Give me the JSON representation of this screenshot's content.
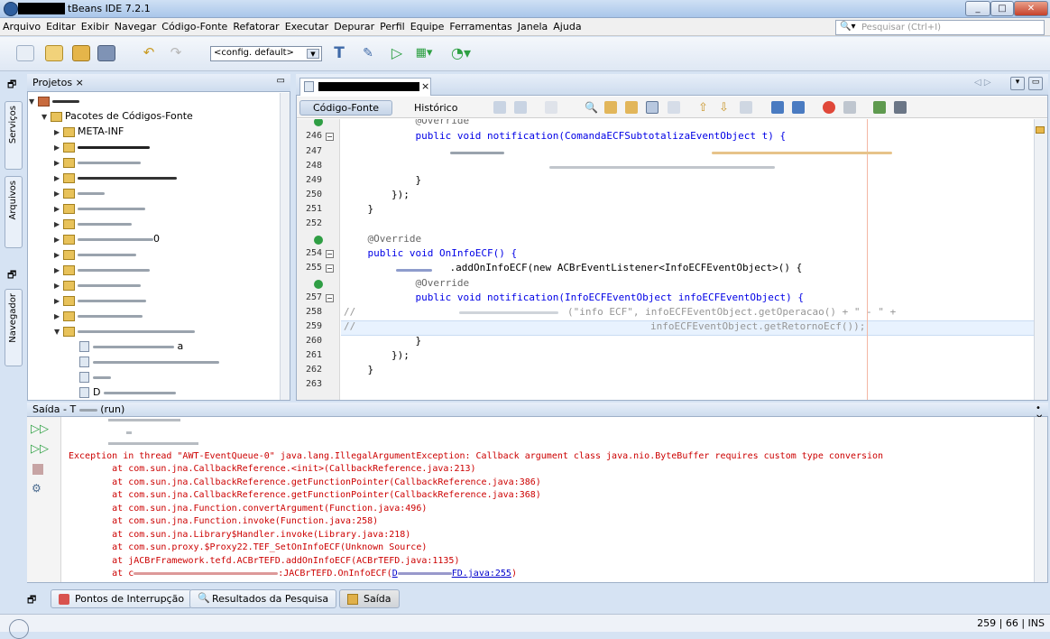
{
  "window": {
    "title": "tBeans IDE 7.2.1",
    "min": "_",
    "max": "□",
    "close": "✕"
  },
  "menu": [
    "Arquivo",
    "Editar",
    "Exibir",
    "Navegar",
    "Código-Fonte",
    "Refatorar",
    "Executar",
    "Depurar",
    "Perfil",
    "Equipe",
    "Ferramentas",
    "Janela",
    "Ajuda"
  ],
  "search": {
    "placeholder": "Pesquisar (Ctrl+I)"
  },
  "toolbar": {
    "config": "<config. default>"
  },
  "side_tabs": {
    "services": "Serviços",
    "files": "Arquivos",
    "navigator": "Navegador"
  },
  "projects": {
    "tab": "Projetos",
    "close": "×",
    "source_packages": "Pacotes de Códigos-Fonte",
    "meta_inf": "META-INF",
    "partial_labels": [
      "0",
      "a",
      "D"
    ]
  },
  "editor": {
    "tab_close": "×",
    "view_source": "Código-Fonte",
    "view_history": "Histórico",
    "lines": [
      {
        "n": "",
        "code": "@Override",
        "cls": "an",
        "indent": "            "
      },
      {
        "n": "246",
        "code": "public void notification(ComandaECFSubtotalizaEventObject t) {",
        "indent": "            "
      },
      {
        "n": "247",
        "code": "",
        "indent": ""
      },
      {
        "n": "248",
        "code": "",
        "indent": ""
      },
      {
        "n": "249",
        "code": "}",
        "indent": "            "
      },
      {
        "n": "250",
        "code": "});",
        "indent": "        "
      },
      {
        "n": "251",
        "code": "}",
        "indent": "    "
      },
      {
        "n": "252",
        "code": "",
        "indent": ""
      },
      {
        "n": "",
        "code": "@Override",
        "indent": "    "
      },
      {
        "n": "254",
        "code": "public void OnInfoECF() {",
        "indent": "    "
      },
      {
        "n": "255",
        "code": ".addOnInfoECF(new ACBrEventListener<InfoECFEventObject>() {",
        "indent": "            "
      },
      {
        "n": "",
        "code": "@Override",
        "indent": "            "
      },
      {
        "n": "257",
        "code": "public void notification(InfoECFEventObject infoECFEventObject) {",
        "indent": "            "
      },
      {
        "n": "258",
        "code": "(\"info ECF\", infoECFEventObject.getOperacao() + \" - \" +",
        "indent": ""
      },
      {
        "n": "259",
        "code": "infoECFEventObject.getRetornoEcf());",
        "indent": ""
      },
      {
        "n": "260",
        "code": "}",
        "indent": "            "
      },
      {
        "n": "261",
        "code": "});",
        "indent": "        "
      },
      {
        "n": "262",
        "code": "}",
        "indent": "    "
      },
      {
        "n": "263",
        "code": "",
        "indent": ""
      }
    ],
    "comment_marker": "//"
  },
  "output": {
    "title": "Saída - T",
    "title_suffix": "(run)",
    "lines": [
      "Exception in thread \"AWT-EventQueue-0\" java.lang.IllegalArgumentException: Callback argument class java.nio.ByteBuffer requires custom type conversion",
      "        at com.sun.jna.CallbackReference.<init>(CallbackReference.java:213)",
      "        at com.sun.jna.CallbackReference.getFunctionPointer(CallbackReference.java:386)",
      "        at com.sun.jna.CallbackReference.getFunctionPointer(CallbackReference.java:368)",
      "        at com.sun.jna.Function.convertArgument(Function.java:496)",
      "        at com.sun.jna.Function.invoke(Function.java:258)",
      "        at com.sun.jna.Library$Handler.invoke(Library.java:218)",
      "        at com.sun.proxy.$Proxy22.TEF_SetOnInfoECF(Unknown Source)",
      "        at jACBrFramework.tefd.ACBrTEFD.addOnInfoECF(ACBrTEFD.java:1135)"
    ],
    "last_prefix": "        at c",
    "last_mid": ":JACBrTEFD.OnInfoECF(",
    "last_link": "D",
    "last_link2": "FD.java:255",
    "last_end": ")"
  },
  "bottom_tabs": [
    "Pontos de Interrupção",
    "Resultados da Pesquisa",
    "Saída"
  ],
  "status": {
    "position": "259 | 66",
    "mode": "INS"
  },
  "colors": {
    "accent": "#d6e3f3",
    "error": "#cc0000",
    "keyword": "#0000e6",
    "highlight": "#e8f2fe"
  }
}
